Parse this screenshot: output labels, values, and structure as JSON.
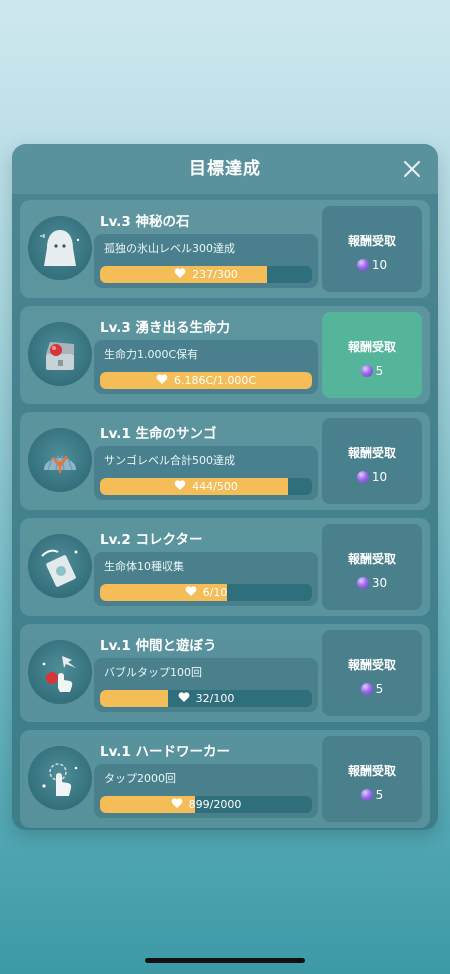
{
  "dialog": {
    "title": "目標達成",
    "close_icon": "close-icon"
  },
  "colors": {
    "bar_fill": "#f4bd57",
    "bar_track": "#2f6e7b",
    "claim_active": "#55b59a",
    "gem": "#9b6be8"
  },
  "goals": [
    {
      "title": "Lv.3 神秘の石",
      "goal": "孤独の氷山レベル300達成",
      "progress_text": "237/300",
      "progress": 0.79,
      "claim_label": "報酬受取",
      "reward": "10",
      "claimable": false,
      "icon": "ghost-stone-icon"
    },
    {
      "title": "Lv.3 湧き出る生命力",
      "goal": "生命力1.000C保有",
      "progress_text": "6.186C/1.000C",
      "progress": 1.0,
      "claim_label": "報酬受取",
      "reward": "5",
      "claimable": true,
      "icon": "treasure-chest-icon"
    },
    {
      "title": "Lv.1 生命のサンゴ",
      "goal": "サンゴレベル合計500達成",
      "progress_text": "444/500",
      "progress": 0.888,
      "claim_label": "報酬受取",
      "reward": "10",
      "claimable": false,
      "icon": "coral-shell-icon"
    },
    {
      "title": "Lv.2 コレクター",
      "goal": "生命体10種収集",
      "progress_text": "6/10",
      "progress": 0.6,
      "claim_label": "報酬受取",
      "reward": "30",
      "claimable": false,
      "icon": "collection-book-icon"
    },
    {
      "title": "Lv.1 仲間と遊ぼう",
      "goal": "バブルタップ100回",
      "progress_text": "32/100",
      "progress": 0.32,
      "claim_label": "報酬受取",
      "reward": "5",
      "claimable": false,
      "icon": "bubble-tap-icon"
    },
    {
      "title": "Lv.1 ハードワーカー",
      "goal": "タップ2000回",
      "progress_text": "899/2000",
      "progress": 0.4495,
      "claim_label": "報酬受取",
      "reward": "5",
      "claimable": false,
      "icon": "tap-hand-icon"
    }
  ]
}
